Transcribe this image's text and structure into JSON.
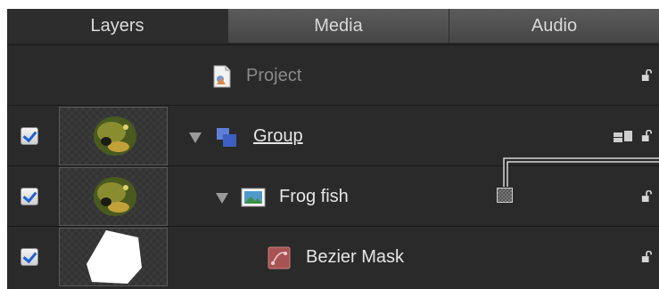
{
  "tabs": [
    {
      "label": "Layers",
      "active": true
    },
    {
      "label": "Media",
      "active": false
    },
    {
      "label": "Audio",
      "active": false
    }
  ],
  "rows": [
    {
      "name": "Project",
      "icon": "project-document-icon",
      "checked": null,
      "dimmed": true
    },
    {
      "name": "Group",
      "icon": "group-layers-icon",
      "checked": true,
      "expanded": true
    },
    {
      "name": "Frog fish",
      "icon": "image-layer-icon",
      "checked": true,
      "expanded": true
    },
    {
      "name": "Bezier Mask",
      "icon": "bezier-mask-icon",
      "checked": true
    }
  ],
  "colors": {
    "background": "#272727",
    "row": "#2a2a2a",
    "text": "#e6e6e6",
    "dimmed_text": "#8a8a8a",
    "accent": "#1f5fd6"
  }
}
